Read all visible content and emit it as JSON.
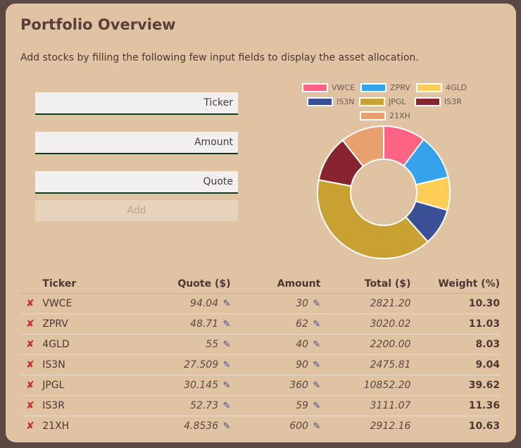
{
  "header": {
    "title": "Portfolio Overview",
    "description": "Add stocks by filling the following few input fields to display the asset allocation."
  },
  "form": {
    "ticker_placeholder": "Ticker",
    "amount_placeholder": "Amount",
    "quote_placeholder": "Quote",
    "add_label": "Add"
  },
  "chart_data": {
    "type": "pie",
    "donut": true,
    "legend_position": "top",
    "categories": [
      "VWCE",
      "ZPRV",
      "4GLD",
      "IS3N",
      "JPGL",
      "IS3R",
      "21XH"
    ],
    "values": [
      10.3,
      11.03,
      8.03,
      9.04,
      39.62,
      11.36,
      10.63
    ],
    "colors": [
      "#fe6383",
      "#36a2eb",
      "#fecd56",
      "#3a4f95",
      "#c9a133",
      "#882330",
      "#e8a06f"
    ]
  },
  "table": {
    "headers": {
      "ticker": "Ticker",
      "quote": "Quote ($)",
      "amount": "Amount",
      "total": "Total ($)",
      "weight": "Weight (%)"
    },
    "delete_glyph": "✘",
    "edit_glyph": "✎",
    "rows": [
      {
        "ticker": "VWCE",
        "quote": "94.04",
        "amount": "30",
        "total": "2821.20",
        "weight": "10.30"
      },
      {
        "ticker": "ZPRV",
        "quote": "48.71",
        "amount": "62",
        "total": "3020.02",
        "weight": "11.03"
      },
      {
        "ticker": "4GLD",
        "quote": "55",
        "amount": "40",
        "total": "2200.00",
        "weight": "8.03"
      },
      {
        "ticker": "IS3N",
        "quote": "27.509",
        "amount": "90",
        "total": "2475.81",
        "weight": "9.04"
      },
      {
        "ticker": "JPGL",
        "quote": "30.145",
        "amount": "360",
        "total": "10852.20",
        "weight": "39.62"
      },
      {
        "ticker": "IS3R",
        "quote": "52.73",
        "amount": "59",
        "total": "3111.07",
        "weight": "11.36"
      },
      {
        "ticker": "21XH",
        "quote": "4.8536",
        "amount": "600",
        "total": "2912.16",
        "weight": "10.63"
      }
    ]
  }
}
